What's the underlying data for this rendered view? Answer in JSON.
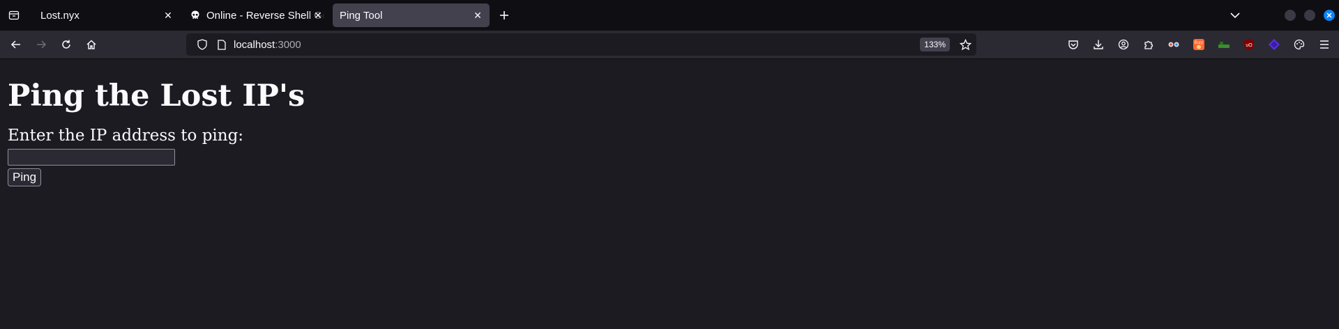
{
  "tabs": [
    {
      "label": "Lost.nyx"
    },
    {
      "label": "Online - Reverse Shell Generator"
    },
    {
      "label": "Ping Tool"
    }
  ],
  "navbar": {
    "url_host": "localhost",
    "url_port": ":3000",
    "zoom": "133%"
  },
  "extensions": [
    {
      "name": "burp-suite-icon",
      "label": "Burp",
      "color": "#ff6633"
    },
    {
      "name": "dark-reader-icon",
      "color": "#3a8f2e"
    },
    {
      "name": "ublock-origin-icon",
      "label": "uD",
      "color": "#800000"
    },
    {
      "name": "purple-extension-icon",
      "color": "#5b2ee0"
    }
  ],
  "page": {
    "heading": "Ping the Lost IP's",
    "prompt": "Enter the IP address to ping:",
    "input_value": "",
    "button_label": "Ping"
  }
}
